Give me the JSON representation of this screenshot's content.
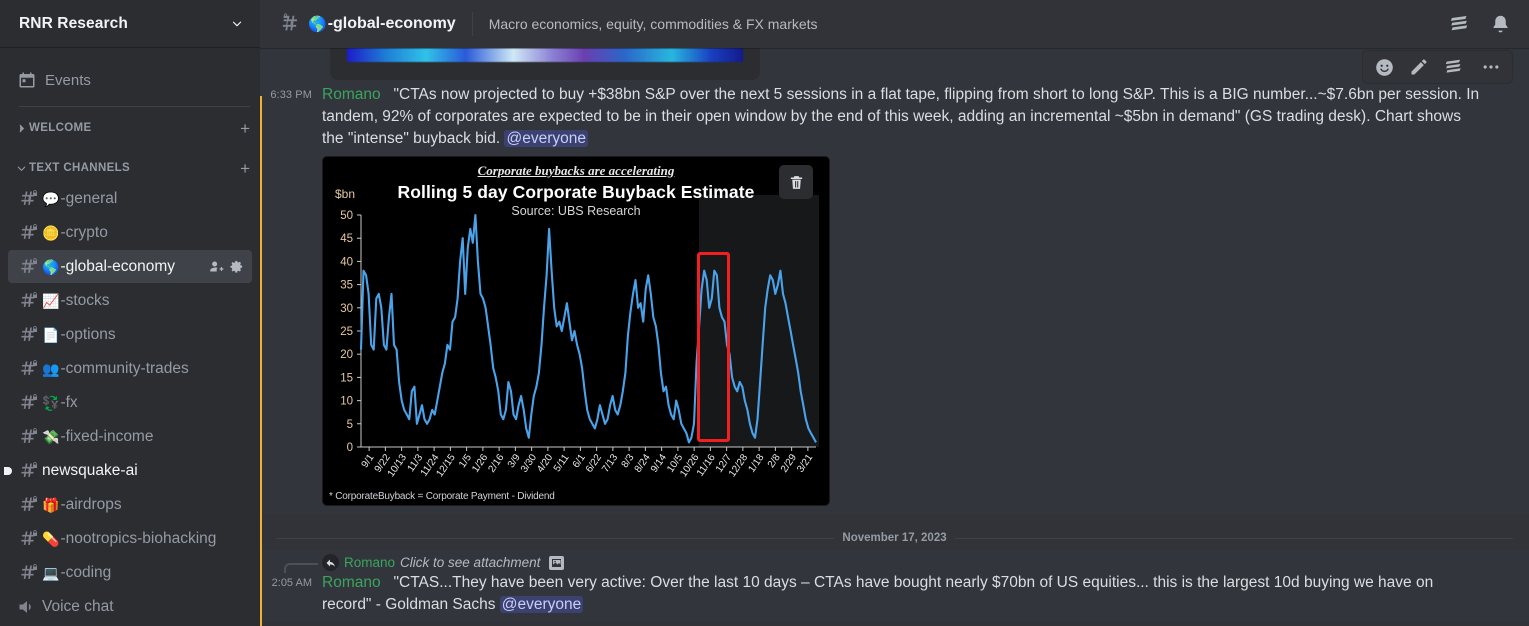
{
  "server": {
    "name": "RNR Research",
    "chevron_icon": "chevron-down-icon"
  },
  "sidebar": {
    "events_label": "Events",
    "events_icon": "calendar-icon",
    "categories": [
      {
        "label": "WELCOME",
        "collapsed": true,
        "add_label": "+"
      },
      {
        "label": "TEXT CHANNELS",
        "collapsed": false,
        "add_label": "+"
      }
    ],
    "channels": [
      {
        "emoji": "💬",
        "name": "-general",
        "state": "normal"
      },
      {
        "emoji": "🪙",
        "name": "-crypto",
        "state": "normal"
      },
      {
        "emoji": "🌎",
        "name": "-global-economy",
        "state": "active"
      },
      {
        "emoji": "📈",
        "name": "-stocks",
        "state": "normal"
      },
      {
        "emoji": "📄",
        "name": "-options",
        "state": "normal"
      },
      {
        "emoji": "👥",
        "name": "-community-trades",
        "state": "normal"
      },
      {
        "emoji": "💱",
        "name": "-fx",
        "state": "normal"
      },
      {
        "emoji": "💸",
        "name": "-fixed-income",
        "state": "normal"
      },
      {
        "emoji": "",
        "name": "newsquake-ai",
        "state": "unread"
      },
      {
        "emoji": "🎁",
        "name": "-airdrops",
        "state": "normal"
      },
      {
        "emoji": "💊",
        "name": "-nootropics-biohacking",
        "state": "normal"
      },
      {
        "emoji": "💻",
        "name": "-coding",
        "state": "normal"
      },
      {
        "emoji": "",
        "name": "Voice chat",
        "state": "voice"
      }
    ],
    "active_channel_actions": [
      {
        "icon": "create-invite-icon"
      },
      {
        "icon": "gear-icon"
      }
    ]
  },
  "topbar": {
    "hash_icon": "hash-lock-icon",
    "emoji": "🌎",
    "title": "-global-economy",
    "topic": "Macro economics, equity, commodities & FX markets",
    "right_icons": [
      {
        "icon": "threads-icon"
      },
      {
        "icon": "bell-icon"
      }
    ]
  },
  "hover_toolbar": {
    "icons": [
      {
        "icon": "add-reaction-icon"
      },
      {
        "icon": "edit-pencil-icon"
      },
      {
        "icon": "threads-icon"
      },
      {
        "icon": "more-options-icon"
      }
    ]
  },
  "messages": [
    {
      "timestamp": "6:33 PM",
      "author": "Romano",
      "text_segments": [
        {
          "t": "\"CTAs now projected to buy +$38bn S&P over the next 5 sessions in a flat tape, flipping from short to long S&P. This is a BIG number...~$7.6bn per session. In tandem, 92% of corporates are expected to be in their open window by the end of this week, adding an incremental ~$5bn in demand\" (GS trading desk). Chart shows the \"intense\" buyback bid. ",
          "type": "text"
        },
        {
          "t": "@everyone",
          "type": "mention"
        }
      ],
      "attachment": {
        "delete_button_icon": "trash-icon",
        "type": "chart-image"
      }
    }
  ],
  "date_divider": "November 17, 2023",
  "reply_message": {
    "reply_ref": {
      "reply_icon": "reply-arrow-icon",
      "author": "Romano",
      "preview": "Click to see attachment",
      "attachment_icon": "image-attachment-icon"
    },
    "timestamp": "2:05 AM",
    "author": "Romano",
    "text": "\"CTAS...They have been very active: Over the last 10 days – CTAs have bought nearly $70bn of US equities... this is the largest 10d buying we have on record\" - Goldman Sachs ",
    "mention": "@everyone"
  },
  "colors": {
    "accent_yellow": "#f0b232",
    "author_green": "#3ba55d",
    "mention_bg": "#3c4270",
    "mention_fg": "#c9cdfb",
    "highlight_red": "#f02020",
    "chart_line": "#4aa3ea",
    "sidebar_bg": "#2b2d31",
    "main_bg": "#313338"
  },
  "chart_data": {
    "type": "line",
    "title": "Rolling 5 day Corporate Buyback Estimate",
    "kicker": "Corporate buybacks are accelerating",
    "subtitle": "Source: UBS Research",
    "footnote": "* CorporateBuyback = Corporate Payment - Dividend",
    "ylabel": "$bn",
    "xlabel": "",
    "ylim": [
      0,
      50
    ],
    "yticks": [
      0,
      5,
      10,
      15,
      20,
      25,
      30,
      35,
      40,
      45,
      50
    ],
    "grid": false,
    "legend": "none",
    "annotation": "red highlight box around recent acceleration (approx. 12/7 - 12/28)",
    "xticks": [
      "9/1",
      "9/22",
      "10/13",
      "11/3",
      "11/24",
      "12/15",
      "1/5",
      "1/26",
      "2/16",
      "3/9",
      "3/30",
      "4/20",
      "5/11",
      "6/1",
      "6/22",
      "7/13",
      "8/3",
      "8/24",
      "9/14",
      "10/5",
      "10/26",
      "11/16",
      "12/7",
      "12/28",
      "1/18",
      "2/8",
      "2/29",
      "3/21"
    ],
    "series": [
      {
        "name": "Rolling 5 day Corporate Buyback Estimate ($bn)",
        "values": [
          21,
          38,
          37,
          33,
          22,
          21,
          32,
          33,
          30,
          22,
          21,
          28,
          33,
          22,
          21,
          14,
          10,
          8,
          7,
          6,
          12,
          13,
          5,
          7,
          9,
          6,
          5,
          6,
          8,
          7,
          10,
          13,
          16,
          18,
          22,
          21,
          27,
          28,
          32,
          40,
          45,
          33,
          43,
          47,
          44,
          50,
          40,
          33,
          32,
          30,
          26,
          22,
          17,
          15,
          12,
          7,
          6,
          8,
          14,
          12,
          7,
          6,
          9,
          11,
          8,
          4,
          2,
          7,
          11,
          13,
          16,
          22,
          30,
          37,
          47,
          38,
          30,
          26,
          27,
          25,
          28,
          31,
          27,
          23,
          25,
          22,
          20,
          17,
          12,
          8,
          6,
          5,
          4,
          6,
          9,
          7,
          5,
          6,
          9,
          11,
          8,
          7,
          9,
          12,
          16,
          24,
          29,
          33,
          36,
          30,
          31,
          27,
          34,
          37,
          33,
          28,
          26,
          22,
          16,
          12,
          13,
          9,
          7,
          6,
          10,
          8,
          5,
          4,
          3,
          1,
          2,
          5,
          18,
          26,
          34,
          38,
          36,
          30,
          32,
          38,
          37,
          30,
          28,
          27,
          22,
          20,
          15,
          13,
          12,
          14,
          13,
          10,
          8,
          5,
          3,
          2,
          6,
          14,
          22,
          30,
          34,
          37,
          36,
          33,
          35,
          38,
          33,
          31,
          28,
          25,
          22,
          19,
          16,
          12,
          9,
          6,
          4,
          3,
          2,
          1
        ]
      }
    ]
  }
}
